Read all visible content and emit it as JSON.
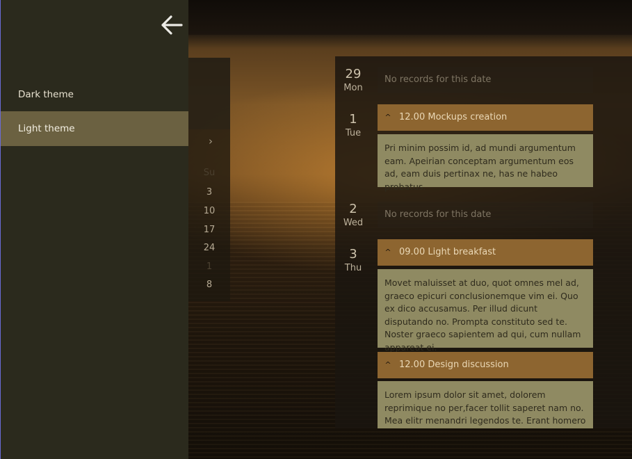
{
  "drawer": {
    "back_icon": "arrow-left-icon",
    "items": [
      {
        "label": "Dark theme",
        "selected": false
      },
      {
        "label": "Light theme",
        "selected": true
      }
    ]
  },
  "calendar": {
    "next_icon": "chevron-right-icon",
    "next_glyph": "›",
    "weekday_header": "Su",
    "days": [
      "3",
      "10",
      "17",
      "24",
      "1",
      "8"
    ]
  },
  "agenda": {
    "days": [
      {
        "number": "29",
        "weekday": "Mon",
        "empty_text": "No records for this date"
      },
      {
        "number": "1",
        "weekday": "Tue",
        "events": [
          {
            "title": "12.00 Mockups creation",
            "body": "Pri minim possim id, ad mundi argumentum eam. Apeirian conceptam argumentum eos ad, eam duis pertinax ne, has ne habeo probatus."
          }
        ]
      },
      {
        "number": "2",
        "weekday": "Wed",
        "empty_text": "No records for this date"
      },
      {
        "number": "3",
        "weekday": "Thu",
        "events": [
          {
            "title": "09.00 Light breakfast",
            "body": "Movet maluisset at duo, quot omnes mel ad, graeco epicuri conclusionemque vim ei. Quo ex dico accusamus. Per illud dicunt disputando no. Prompta constituto sed te. Noster graeco sapientem ad qui, cum nullam appareat ei."
          },
          {
            "title": "12.00 Design discussion",
            "body": "Lorem ipsum dolor sit amet, dolorem reprimique no per,facer tollit saperet nam no. Mea elitr menandri legendos te. Erant homero"
          }
        ]
      }
    ],
    "collapse_icon": "chevron-up-icon",
    "collapse_glyph": "^"
  }
}
